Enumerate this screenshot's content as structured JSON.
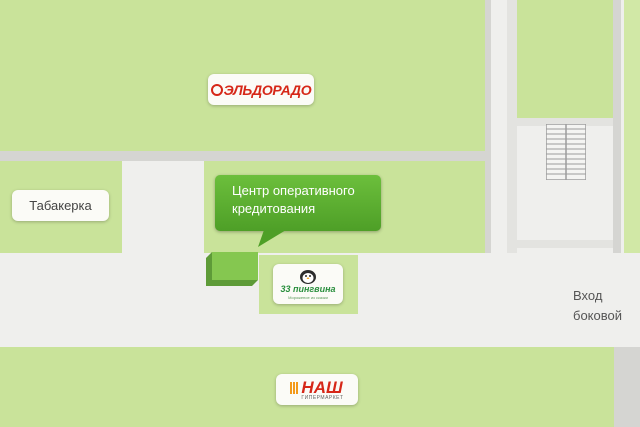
{
  "stores": {
    "eldorado": {
      "logo_text": "ЭЛЬДОРАДО"
    },
    "tabakerka": {
      "label": "Табакерка"
    },
    "pingvina": {
      "logo_text": "33 пингвина",
      "tagline": "Мороженое из сказки"
    },
    "nash": {
      "logo_text": "НАШ",
      "sub_text": "ГИПЕРМАРКЕТ"
    }
  },
  "callout": {
    "text": "Центр оперативного\nкредитования"
  },
  "entrance": {
    "line1": "Вход",
    "line2": "боковой"
  },
  "colors": {
    "zone": "#c9e39a",
    "corridor": "#efefed",
    "wall": "#d5d5d2",
    "callout": "#57ac2c",
    "highlight_box": "#7dc24a",
    "brand_red": "#d62718"
  }
}
